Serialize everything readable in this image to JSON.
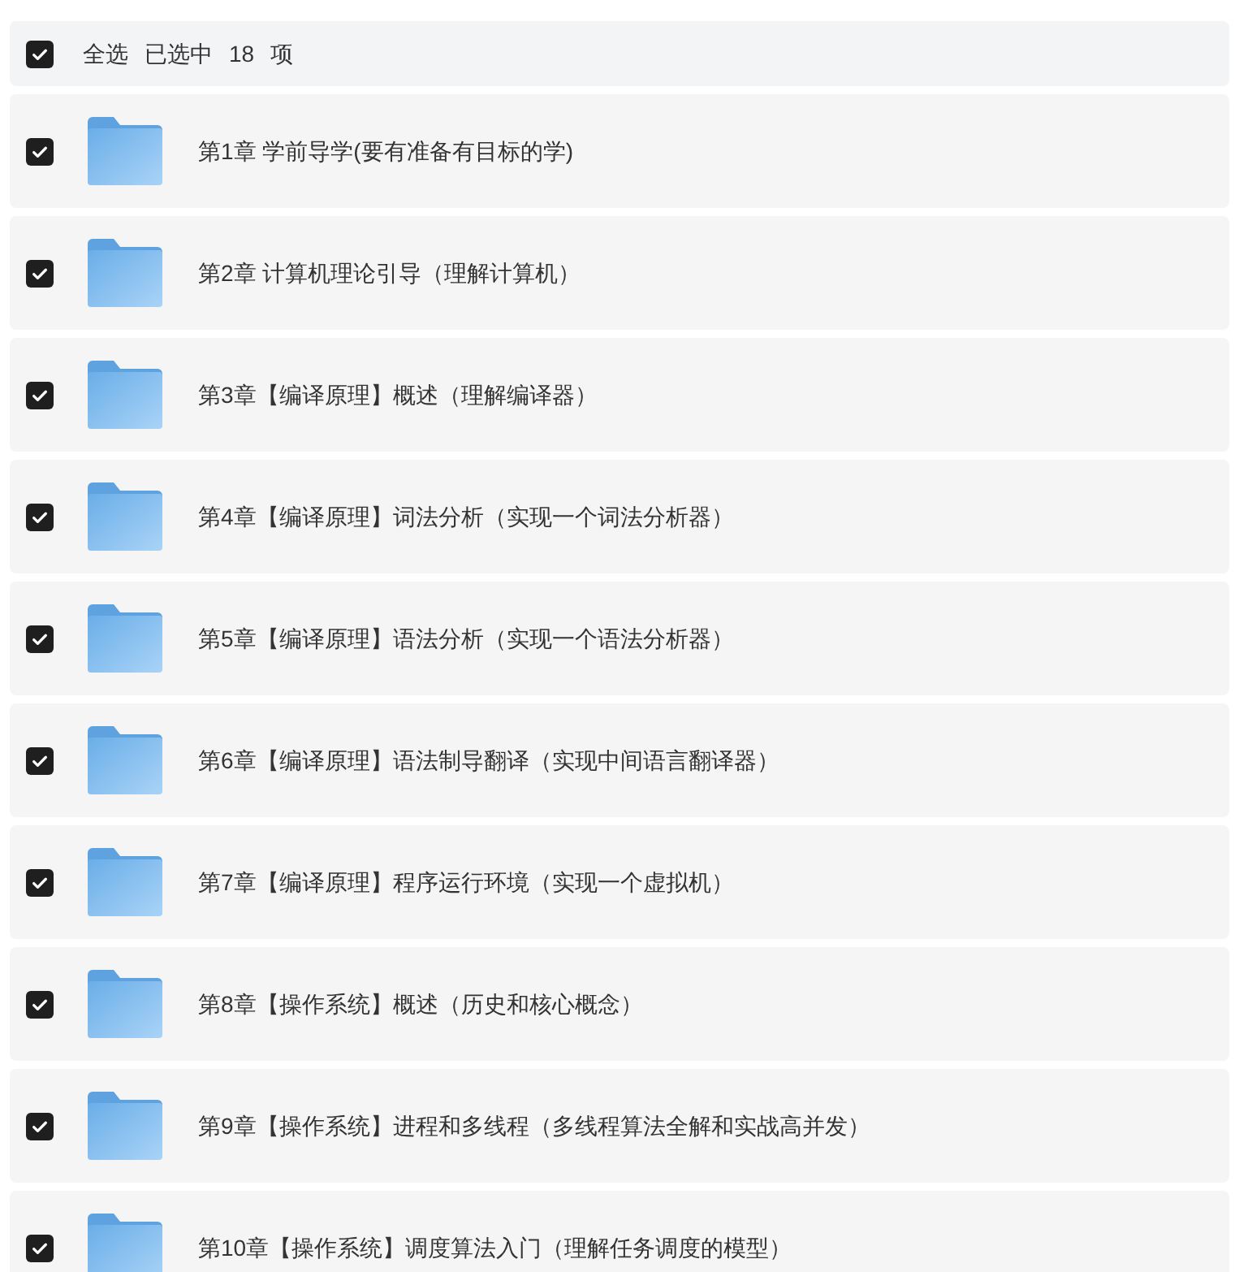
{
  "header": {
    "checked": true,
    "label": "全选",
    "prefix": "已选中",
    "count": "18",
    "suffix": "项"
  },
  "items": [
    {
      "title": "第1章 学前导学(要有准备有目标的学)",
      "checked": true
    },
    {
      "title": "第2章 计算机理论引导（理解计算机）",
      "checked": true
    },
    {
      "title": "第3章【编译原理】概述（理解编译器）",
      "checked": true
    },
    {
      "title": "第4章【编译原理】词法分析（实现一个词法分析器）",
      "checked": true
    },
    {
      "title": "第5章【编译原理】语法分析（实现一个语法分析器）",
      "checked": true
    },
    {
      "title": "第6章【编译原理】语法制导翻译（实现中间语言翻译器）",
      "checked": true
    },
    {
      "title": "第7章【编译原理】程序运行环境（实现一个虚拟机）",
      "checked": true
    },
    {
      "title": "第8章【操作系统】概述（历史和核心概念）",
      "checked": true
    },
    {
      "title": "第9章【操作系统】进程和多线程（多线程算法全解和实战高并发）",
      "checked": true
    },
    {
      "title": "第10章【操作系统】调度算法入门（理解任务调度的模型）",
      "checked": true
    }
  ]
}
